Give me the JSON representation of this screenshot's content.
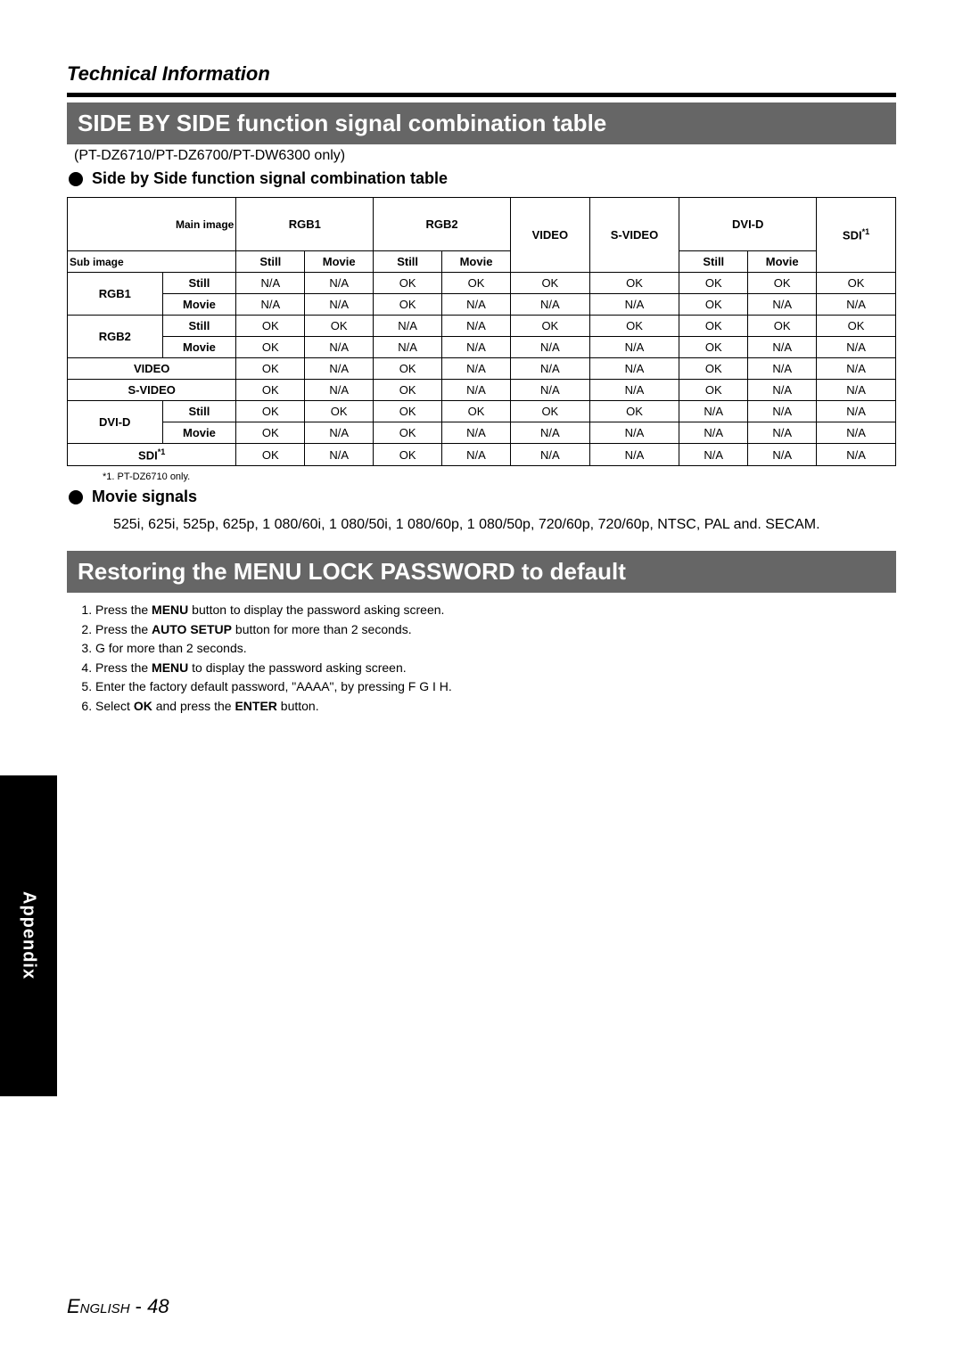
{
  "header": {
    "title": "Technical Information"
  },
  "section1": {
    "banner": "SIDE BY SIDE function signal combination table",
    "model_note": "(PT-DZ6710/PT-DZ6700/PT-DW6300 only)",
    "bullet": "Side by Side function signal combination table"
  },
  "table": {
    "main_image_label": "Main image",
    "sub_image_label": "Sub image",
    "col_groups": [
      "RGB1",
      "RGB2",
      "VIDEO",
      "S-VIDEO",
      "DVI-D",
      "SDI"
    ],
    "sdi_sup": "*1",
    "sub_cols": {
      "still": "Still",
      "movie": "Movie"
    },
    "rows": [
      {
        "group": "RGB1",
        "sub": "Still",
        "cells": [
          "N/A",
          "N/A",
          "OK",
          "OK",
          "OK",
          "OK",
          "OK",
          "OK",
          "OK"
        ]
      },
      {
        "group": "RGB1",
        "sub": "Movie",
        "cells": [
          "N/A",
          "N/A",
          "OK",
          "N/A",
          "N/A",
          "N/A",
          "OK",
          "N/A",
          "N/A"
        ]
      },
      {
        "group": "RGB2",
        "sub": "Still",
        "cells": [
          "OK",
          "OK",
          "N/A",
          "N/A",
          "OK",
          "OK",
          "OK",
          "OK",
          "OK"
        ]
      },
      {
        "group": "RGB2",
        "sub": "Movie",
        "cells": [
          "OK",
          "N/A",
          "N/A",
          "N/A",
          "N/A",
          "N/A",
          "OK",
          "N/A",
          "N/A"
        ]
      },
      {
        "group": "VIDEO",
        "sub": "",
        "cells": [
          "OK",
          "N/A",
          "OK",
          "N/A",
          "N/A",
          "N/A",
          "OK",
          "N/A",
          "N/A"
        ]
      },
      {
        "group": "S-VIDEO",
        "sub": "",
        "cells": [
          "OK",
          "N/A",
          "OK",
          "N/A",
          "N/A",
          "N/A",
          "OK",
          "N/A",
          "N/A"
        ]
      },
      {
        "group": "DVI-D",
        "sub": "Still",
        "cells": [
          "OK",
          "OK",
          "OK",
          "OK",
          "OK",
          "OK",
          "N/A",
          "N/A",
          "N/A"
        ]
      },
      {
        "group": "DVI-D",
        "sub": "Movie",
        "cells": [
          "OK",
          "N/A",
          "OK",
          "N/A",
          "N/A",
          "N/A",
          "N/A",
          "N/A",
          "N/A"
        ]
      },
      {
        "group": "SDI",
        "sub": "",
        "cells": [
          "OK",
          "N/A",
          "OK",
          "N/A",
          "N/A",
          "N/A",
          "N/A",
          "N/A",
          "N/A"
        ]
      }
    ],
    "footnote": "*1.  PT-DZ6710 only."
  },
  "movie_signals": {
    "heading": "Movie signals",
    "text": "525i, 625i, 525p, 625p, 1 080/60i, 1 080/50i, 1 080/60p, 1 080/50p, 720/60p, 720/60p, NTSC, PAL and. SECAM."
  },
  "section2": {
    "banner": "Restoring the MENU LOCK PASSWORD to default",
    "steps": [
      {
        "pre": "Press the ",
        "b1": "MENU",
        "mid": " button to display the password asking screen.",
        "b2": "",
        "post": ""
      },
      {
        "pre": "Press the ",
        "b1": "AUTO SETUP",
        "mid": " button for more than 2 seconds.",
        "b2": "",
        "post": ""
      },
      {
        "pre": "G for more than 2 seconds.",
        "b1": "",
        "mid": "",
        "b2": "",
        "post": ""
      },
      {
        "pre": "Press the ",
        "b1": "MENU",
        "mid": " to display the password asking screen.",
        "b2": "",
        "post": ""
      },
      {
        "pre": "Enter the factory default password, \"AAAA\", by pressing F  G  I   H.",
        "b1": "",
        "mid": "",
        "b2": "",
        "post": ""
      },
      {
        "pre": "Select ",
        "b1": "OK",
        "mid": " and press the ",
        "b2": "ENTER",
        "post": " button."
      }
    ]
  },
  "side_tab": "Appendix",
  "footer": {
    "language": "English",
    "dash": " - ",
    "page": "48"
  },
  "chart_data": {
    "type": "table",
    "title": "Side by Side function signal combination table",
    "columns": [
      "RGB1 Still",
      "RGB1 Movie",
      "RGB2 Still",
      "RGB2 Movie",
      "VIDEO",
      "S-VIDEO",
      "DVI-D Still",
      "DVI-D Movie",
      "SDI*1"
    ],
    "rows": [
      "RGB1 Still",
      "RGB1 Movie",
      "RGB2 Still",
      "RGB2 Movie",
      "VIDEO",
      "S-VIDEO",
      "DVI-D Still",
      "DVI-D Movie",
      "SDI*1"
    ],
    "values": [
      [
        "N/A",
        "N/A",
        "OK",
        "OK",
        "OK",
        "OK",
        "OK",
        "OK",
        "OK"
      ],
      [
        "N/A",
        "N/A",
        "OK",
        "N/A",
        "N/A",
        "N/A",
        "OK",
        "N/A",
        "N/A"
      ],
      [
        "OK",
        "OK",
        "N/A",
        "N/A",
        "OK",
        "OK",
        "OK",
        "OK",
        "OK"
      ],
      [
        "OK",
        "N/A",
        "N/A",
        "N/A",
        "N/A",
        "N/A",
        "OK",
        "N/A",
        "N/A"
      ],
      [
        "OK",
        "N/A",
        "OK",
        "N/A",
        "N/A",
        "N/A",
        "OK",
        "N/A",
        "N/A"
      ],
      [
        "OK",
        "N/A",
        "OK",
        "N/A",
        "N/A",
        "N/A",
        "OK",
        "N/A",
        "N/A"
      ],
      [
        "OK",
        "OK",
        "OK",
        "OK",
        "OK",
        "OK",
        "N/A",
        "N/A",
        "N/A"
      ],
      [
        "OK",
        "N/A",
        "OK",
        "N/A",
        "N/A",
        "N/A",
        "N/A",
        "N/A",
        "N/A"
      ],
      [
        "OK",
        "N/A",
        "OK",
        "N/A",
        "N/A",
        "N/A",
        "N/A",
        "N/A",
        "N/A"
      ]
    ]
  }
}
